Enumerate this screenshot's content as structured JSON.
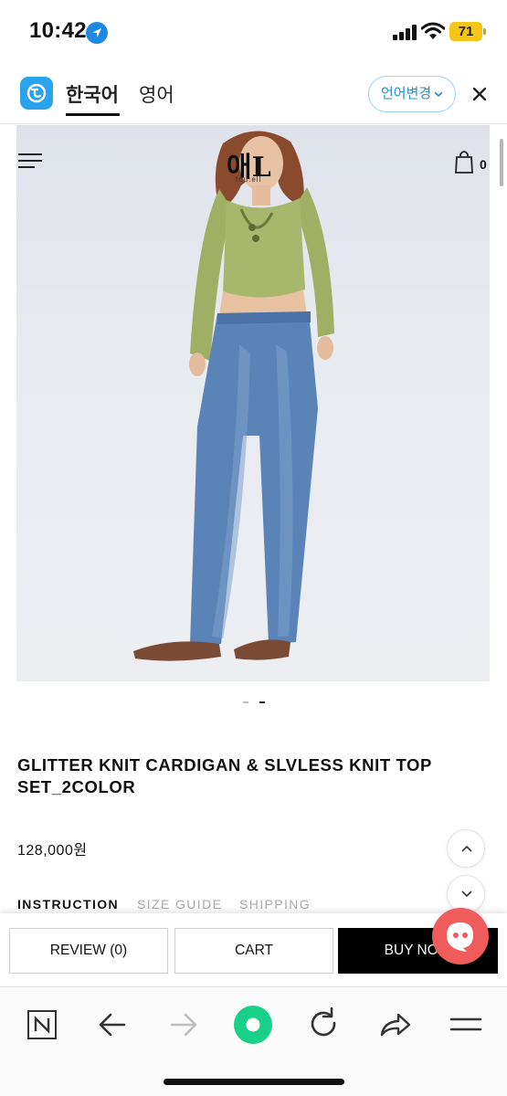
{
  "status_bar": {
    "time": "10:42",
    "battery": "71",
    "icons": [
      "location-arrow-icon",
      "signal-icon",
      "wifi-icon",
      "battery-icon"
    ]
  },
  "translate_bar": {
    "tab_active": "한국어",
    "tab_other": "영어",
    "change_label": "언어변경",
    "accent_color": "#2aa3ee"
  },
  "shop": {
    "logo": "애L",
    "logo_sub": "fou:ell",
    "cart_count": "0"
  },
  "product": {
    "title": "GLITTER KNIT CARDIGAN & SLVLESS KNIT TOP SET_2COLOR",
    "price": "128,000원",
    "carousel_total": 2,
    "carousel_active": 2
  },
  "info_tabs": {
    "instruction": "INSTRUCTION",
    "size_guide": "SIZE GUIDE",
    "shipping": "SHIPPING"
  },
  "purchase_bar": {
    "review": "REVIEW (0)",
    "cart": "CART",
    "buy_now": "BUY NOW"
  },
  "browser_toolbar": {
    "icons": [
      "naver-n-icon",
      "back-arrow-icon",
      "forward-arrow-icon",
      "green-dot-home-icon",
      "refresh-icon",
      "share-icon",
      "menu-icon"
    ],
    "accent_color": "#19d08a"
  },
  "colors": {
    "chat_button": "#f05b5b",
    "buy_now_bg": "#000000"
  }
}
